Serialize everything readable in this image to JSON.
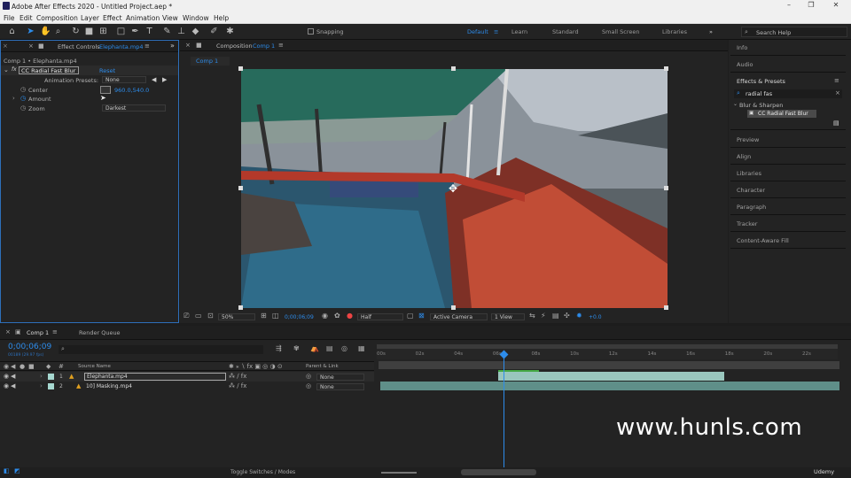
{
  "app": {
    "title": "Adobe After Effects 2020 - Untitled Project.aep *"
  },
  "menu": [
    "File",
    "Edit",
    "Composition",
    "Layer",
    "Effect",
    "Animation",
    "View",
    "Window",
    "Help"
  ],
  "toolbar": {
    "snapping": "Snapping"
  },
  "workspaces": [
    "Default",
    "Learn",
    "Standard",
    "Small Screen",
    "Libraries"
  ],
  "search_help": "Search Help",
  "effect_controls": {
    "tab": "Effect Controls",
    "file": "Elephanta.mp4",
    "layer_path": "Comp 1 • Elephanta.mp4",
    "effect_name": "CC Radial Fast Blur",
    "reset": "Reset",
    "presets_label": "Animation Presets:",
    "presets_value": "None",
    "center_label": "Center",
    "center_value": "960.0,540.0",
    "amount_label": "Amount",
    "zoom_label": "Zoom",
    "zoom_value": "Darkest"
  },
  "composition": {
    "tab_prefix": "Composition",
    "tab_name": "Comp 1",
    "crumb": "Comp 1",
    "zoom": "50%",
    "timecode": "0;00;06;09",
    "resolution": "Half",
    "camera": "Active Camera",
    "views": "1 View",
    "offset": "+0.0"
  },
  "right_panel": {
    "info": "Info",
    "audio": "Audio",
    "effects_presets": "Effects & Presets",
    "search_value": "radial fas",
    "category": "Blur & Sharpen",
    "result": "CC Radial Fast Blur",
    "items": [
      "Preview",
      "Align",
      "Libraries",
      "Character",
      "Paragraph",
      "Tracker",
      "Content-Aware Fill"
    ]
  },
  "timeline": {
    "tab": "Comp 1",
    "render_queue": "Render Queue",
    "timecode": "0;00;06;09",
    "fps": "00189 (29.97 fps)",
    "source_name_hdr": "Source Name",
    "parent_hdr": "Parent & Link",
    "layers": [
      {
        "num": "1",
        "name": "Elephanta.mp4",
        "parent": "None"
      },
      {
        "num": "2",
        "name": "10] Masking.mp4",
        "parent": "None"
      }
    ],
    "ticks": [
      "00s",
      "02s",
      "04s",
      "06s",
      "08s",
      "10s",
      "12s",
      "14s",
      "16s",
      "18s",
      "20s",
      "22s"
    ],
    "toggle": "Toggle Switches / Modes",
    "playhead_fraction": 0.31
  },
  "branding": {
    "udemy": "Udemy",
    "watermark": "www.hunls.com"
  }
}
